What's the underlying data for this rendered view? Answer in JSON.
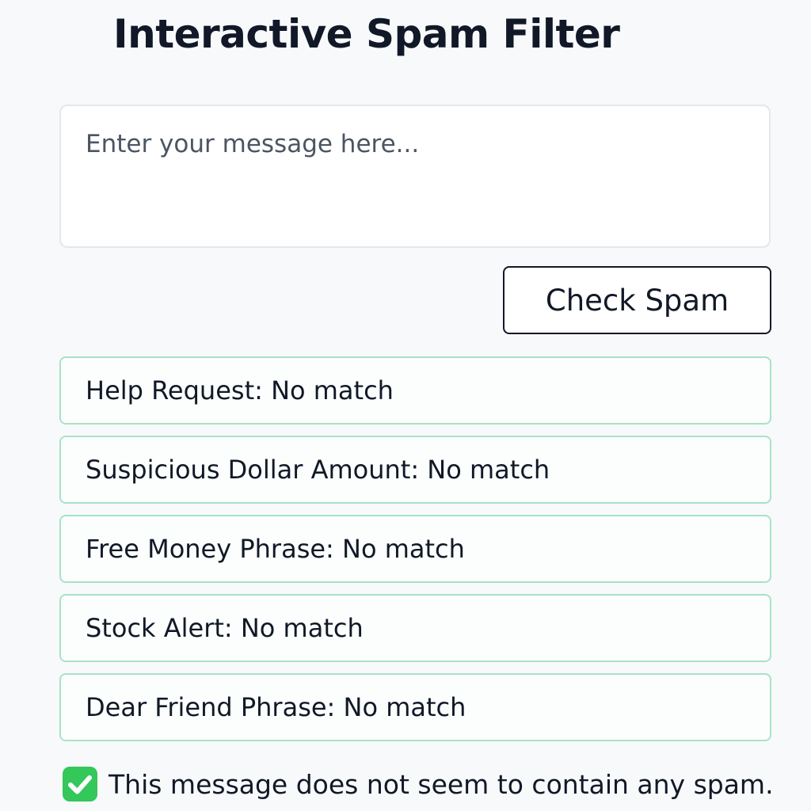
{
  "page": {
    "title": "Interactive Spam Filter"
  },
  "input": {
    "value": "",
    "placeholder": "Enter your message here..."
  },
  "button": {
    "label": "Check Spam"
  },
  "results": [
    {
      "name": "Help Request",
      "status": "No match",
      "text": "Help Request: No match"
    },
    {
      "name": "Suspicious Dollar Amount",
      "status": "No match",
      "text": "Suspicious Dollar Amount: No match"
    },
    {
      "name": "Free Money Phrase",
      "status": "No match",
      "text": "Free Money Phrase: No match"
    },
    {
      "name": "Stock Alert",
      "status": "No match",
      "text": "Stock Alert: No match"
    },
    {
      "name": "Dear Friend Phrase",
      "status": "No match",
      "text": "Dear Friend Phrase: No match"
    }
  ],
  "verdict": {
    "icon": "check-mark-icon",
    "text": "This message does not seem to contain any spam."
  },
  "colors": {
    "background": "#f8f9fb",
    "result_border": "#a7e3c6",
    "check_green": "#34c759"
  }
}
